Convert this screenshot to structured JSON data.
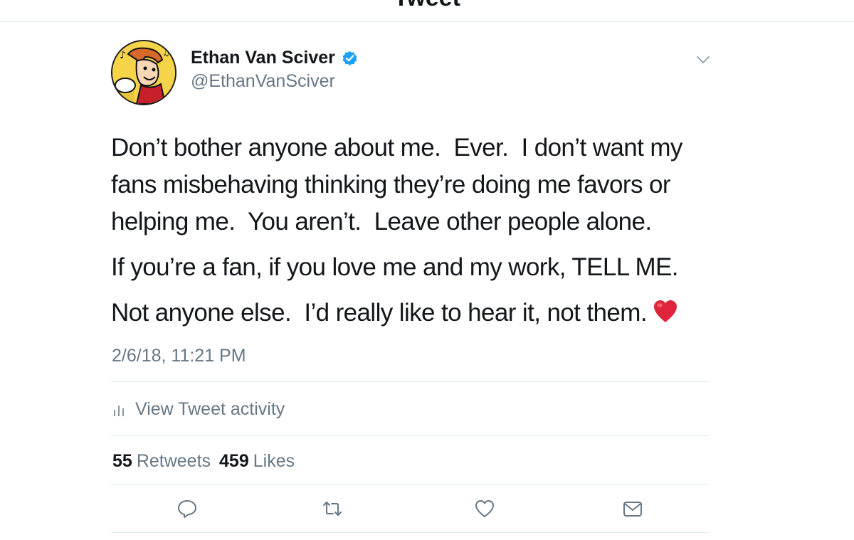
{
  "header": {
    "title": "Tweet"
  },
  "author": {
    "display_name": "Ethan Van Sciver",
    "handle": "@EthanVanSciver",
    "verified": true,
    "verified_color": "#1da1f2"
  },
  "tweet": {
    "lines": [
      "Don’t bother anyone about me.  Ever.  I don’t want my",
      "fans misbehaving thinking they’re doing me favors or",
      "helping me.  You aren’t.  Leave other people alone."
    ],
    "line_2": "If you’re a fan, if you love me and my work, TELL ME.",
    "line_3": "Not anyone else.  I’d really like to hear it, not them.",
    "emoji": "red-heart"
  },
  "timestamp": "2/6/18, 11:21 PM",
  "activity": {
    "label": "View Tweet activity",
    "icon": "bar-chart-icon"
  },
  "stats": {
    "retweets_count": "55",
    "retweets_label": "Retweets",
    "likes_count": "459",
    "likes_label": "Likes"
  },
  "actions": {
    "icons": [
      "reply-icon",
      "retweet-icon",
      "like-icon",
      "share-icon"
    ]
  },
  "colors": {
    "text_primary": "#14171a",
    "text_secondary": "#657786",
    "divider": "#e1e8ed",
    "heart": "#e0243c"
  }
}
